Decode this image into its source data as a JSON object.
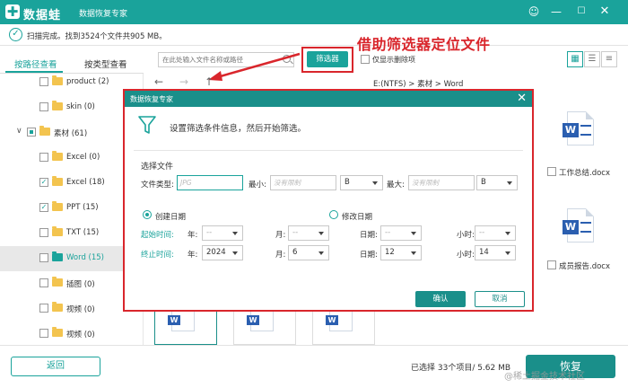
{
  "app": {
    "name": "数据蛙",
    "title": "数据恢复专家"
  },
  "window_controls": [
    "menu-icon",
    "minimize-icon",
    "maximize-icon",
    "close-icon"
  ],
  "status": {
    "text": "扫描完成。找到3524个文件共905 MB。"
  },
  "tabs": [
    {
      "label": "按路径查看",
      "active": true
    },
    {
      "label": "按类型查看",
      "active": false
    }
  ],
  "sidebar": {
    "items": [
      {
        "label": "product (2)",
        "checked": false,
        "folder": "yellow",
        "level": 1
      },
      {
        "label": "skin (0)",
        "checked": false,
        "folder": "yellow",
        "level": 1
      },
      {
        "label": "素材 (61)",
        "checked": "partial",
        "folder": "yellow",
        "level": 0,
        "expanded": true
      },
      {
        "label": "Excel (0)",
        "checked": false,
        "folder": "yellow",
        "level": 1
      },
      {
        "label": "Excel (18)",
        "checked": true,
        "folder": "yellow",
        "level": 1
      },
      {
        "label": "PPT (15)",
        "checked": true,
        "folder": "yellow",
        "level": 1
      },
      {
        "label": "TXT (15)",
        "checked": false,
        "folder": "yellow",
        "level": 1
      },
      {
        "label": "Word (15)",
        "checked": false,
        "folder": "blue",
        "level": 1,
        "selected": true
      },
      {
        "label": "插图 (0)",
        "checked": false,
        "folder": "yellow",
        "level": 1
      },
      {
        "label": "视频 (0)",
        "checked": false,
        "folder": "yellow",
        "level": 1
      },
      {
        "label": "视频 (0)",
        "checked": false,
        "folder": "yellow",
        "level": 1
      }
    ]
  },
  "toolbar": {
    "search_placeholder": "在此处输入文件名称或路径",
    "filter_label": "筛选器",
    "only_deleted_label": "仅显示删除项"
  },
  "annotation": "借助筛选器定位文件",
  "pathbar": {
    "path": "E:(NTFS) > 素材 > Word"
  },
  "files": [
    {
      "name": "工作总结.docx",
      "checked": false
    },
    {
      "name": "成员报告.docx",
      "checked": false
    }
  ],
  "dialog": {
    "title": "数据恢复专家",
    "hint": "设置筛选条件信息，然后开始筛选。",
    "section": "选择文件",
    "file_type_label": "文件类型:",
    "file_type_placeholder": "JPG",
    "min_label": "最小:",
    "min_placeholder": "没有限制",
    "min_unit": "B",
    "max_label": "最大:",
    "max_placeholder": "没有限制",
    "max_unit": "B",
    "create_date_label": "创建日期",
    "modify_date_label": "修改日期",
    "date_mode": "create",
    "start_label": "起始时间:",
    "end_label": "终止时间:",
    "year_label": "年:",
    "month_label": "月:",
    "day_label": "日期:",
    "hour_label": "小时:",
    "start": {
      "year": "--",
      "month": "--",
      "day": "--",
      "hour": "--"
    },
    "end": {
      "year": "2024",
      "month": "6",
      "day": "12",
      "hour": "14"
    },
    "ok_label": "确认",
    "cancel_label": "取消"
  },
  "footer": {
    "back_label": "返回",
    "selection_info": "已选择 33个项目/ 5.62 MB",
    "recover_label": "恢复"
  },
  "watermark": "@稀土掘金技术社区",
  "colors": {
    "accent": "#1aa39b",
    "dark_accent": "#1a8f8a",
    "annotation_red": "#d9262c",
    "word_blue": "#2b5fb0",
    "folder_yellow": "#f3c44f"
  }
}
